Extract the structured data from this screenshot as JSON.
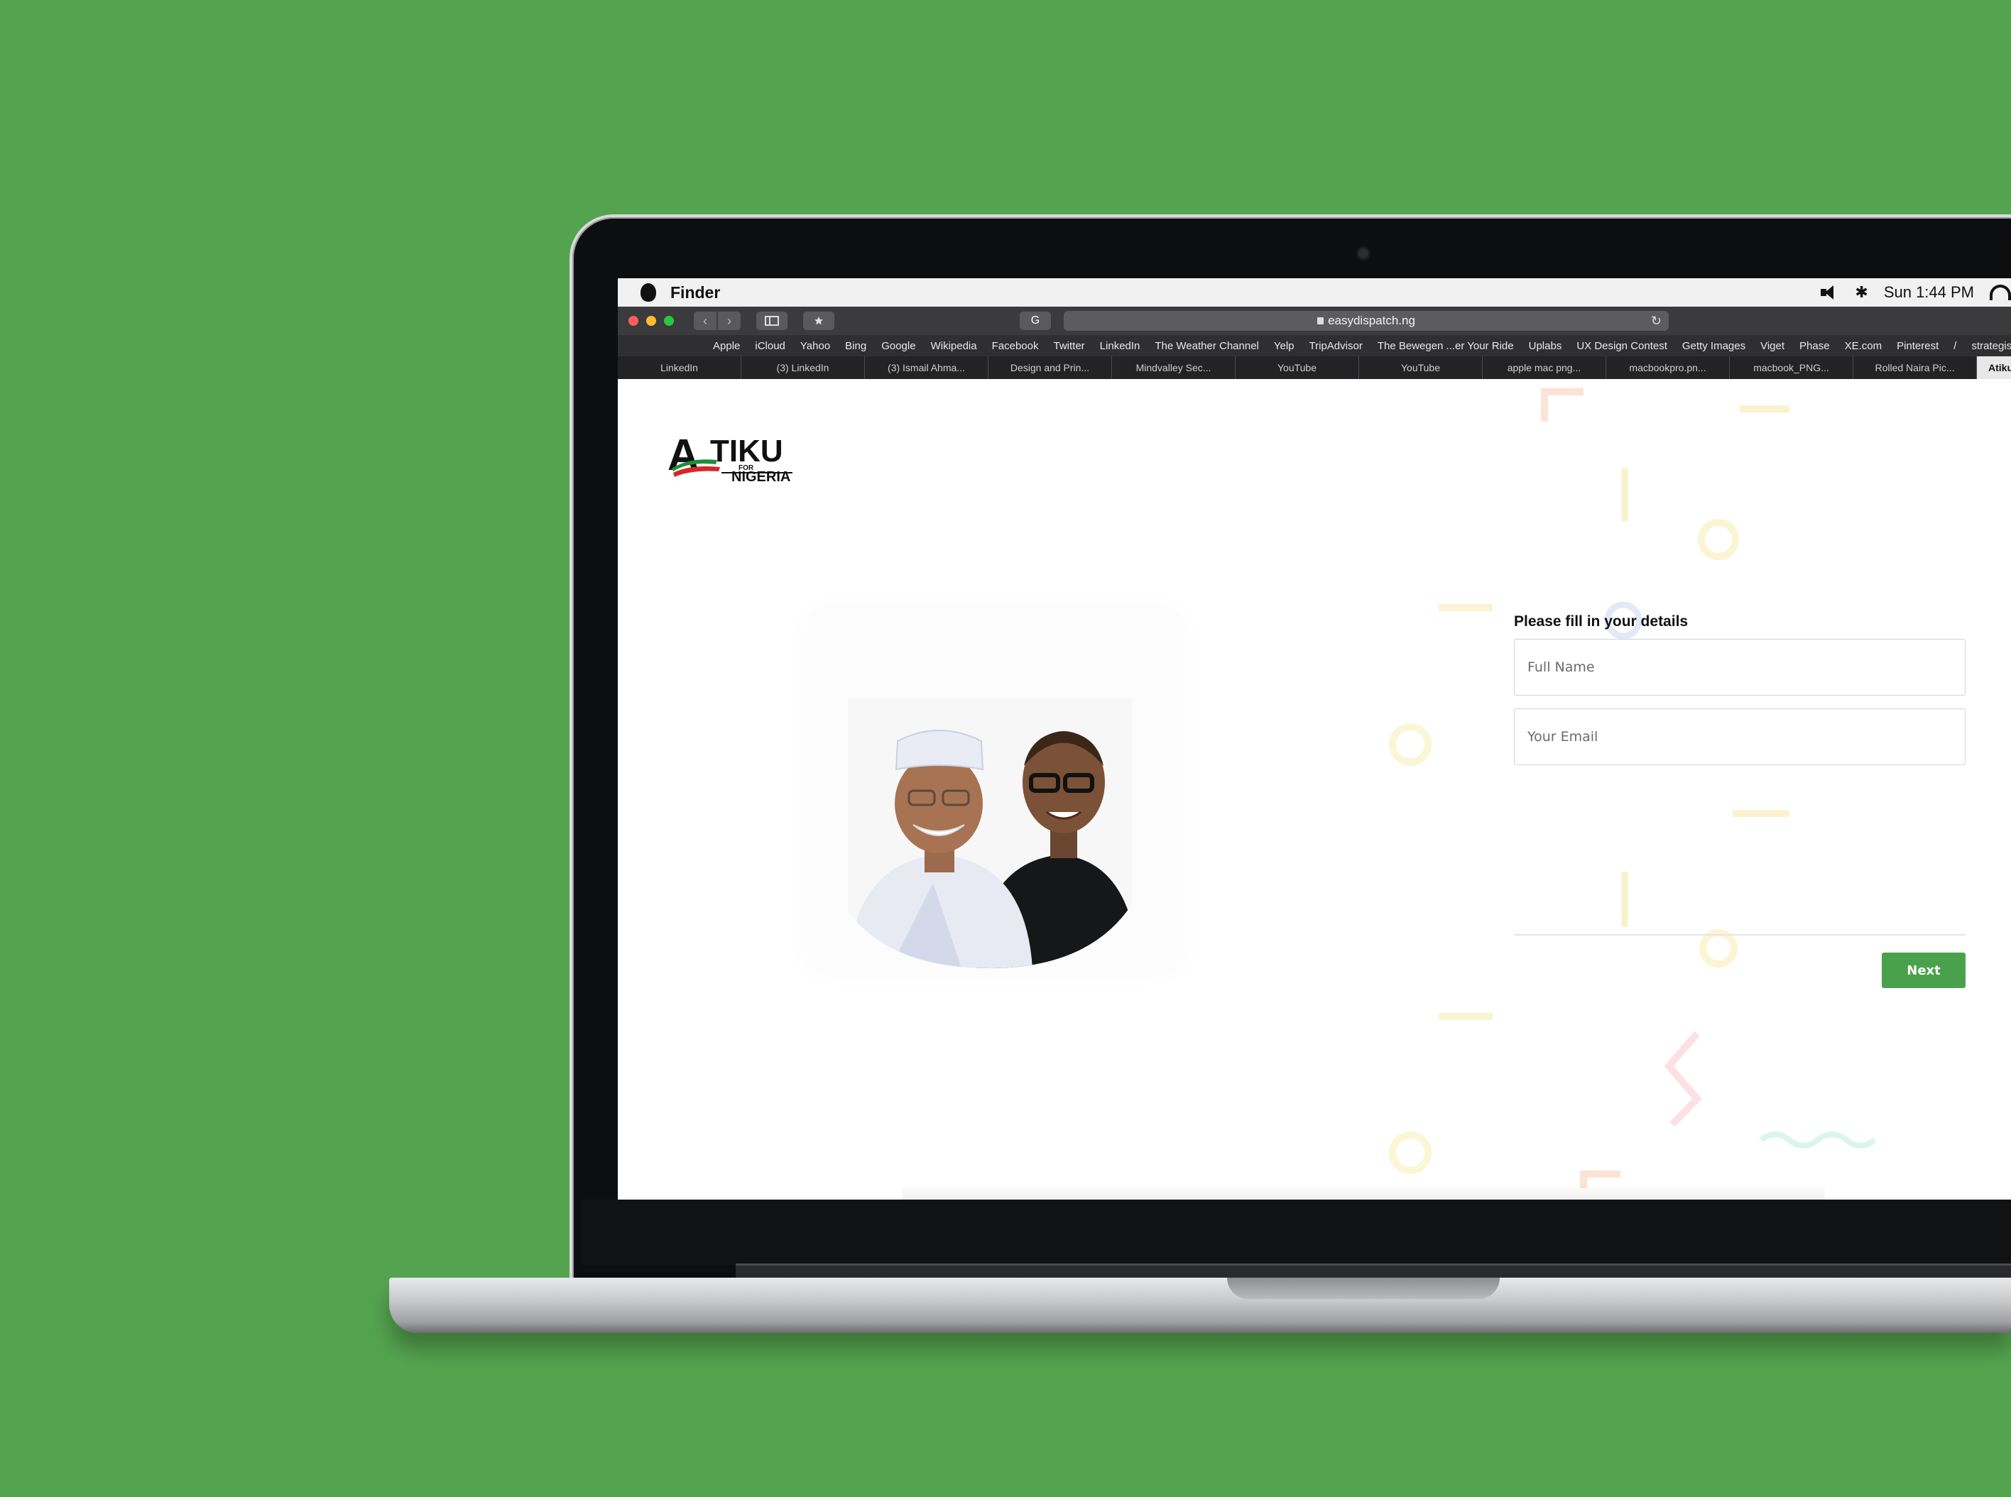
{
  "menubar": {
    "app_name": "Finder",
    "clock": "Sun 1:44 PM",
    "bluetooth_glyph": "✱"
  },
  "browser": {
    "url": "easydispatch.ng",
    "nav_back": "‹",
    "nav_forward": "›",
    "grammarly_glyph": "G",
    "reload_glyph": "↻",
    "bookmarks": [
      "Apple",
      "iCloud",
      "Yahoo",
      "Bing",
      "Google",
      "Wikipedia",
      "Facebook",
      "Twitter",
      "LinkedIn",
      "The Weather Channel",
      "Yelp",
      "TripAdvisor",
      "The Bewegen ...er Your Ride",
      "Uplabs",
      "UX Design Contest",
      "Getty Images",
      "Viget",
      "Phase",
      "XE.com",
      "Pinterest",
      "/",
      "strategist"
    ],
    "tabs": [
      "LinkedIn",
      "(3) LinkedIn",
      "(3) Ismail Ahma...",
      "Design and Prin...",
      "Mindvalley Sec...",
      "YouTube",
      "YouTube",
      "apple mac png...",
      "macbookpro.pn...",
      "macbook_PNG...",
      "Rolled Naira Pic...",
      "Atiku"
    ]
  },
  "logo": {
    "text_main": "TIKU",
    "text_initial": "A",
    "text_for": "FOR",
    "text_nigeria": "NIGERIA"
  },
  "form": {
    "title": "Please fill in your details",
    "full_name_placeholder": "Full Name",
    "email_placeholder": "Your Email",
    "next_label": "Next"
  },
  "colors": {
    "background": "#54a44f",
    "accent": "#4aa14b",
    "flag_green": "#1a8f3c",
    "flag_red": "#d62828"
  },
  "icons": [
    "apple-icon",
    "speaker-icon",
    "bluetooth-icon",
    "wifi-icon",
    "lock-icon",
    "reload-icon",
    "grid-icon"
  ]
}
